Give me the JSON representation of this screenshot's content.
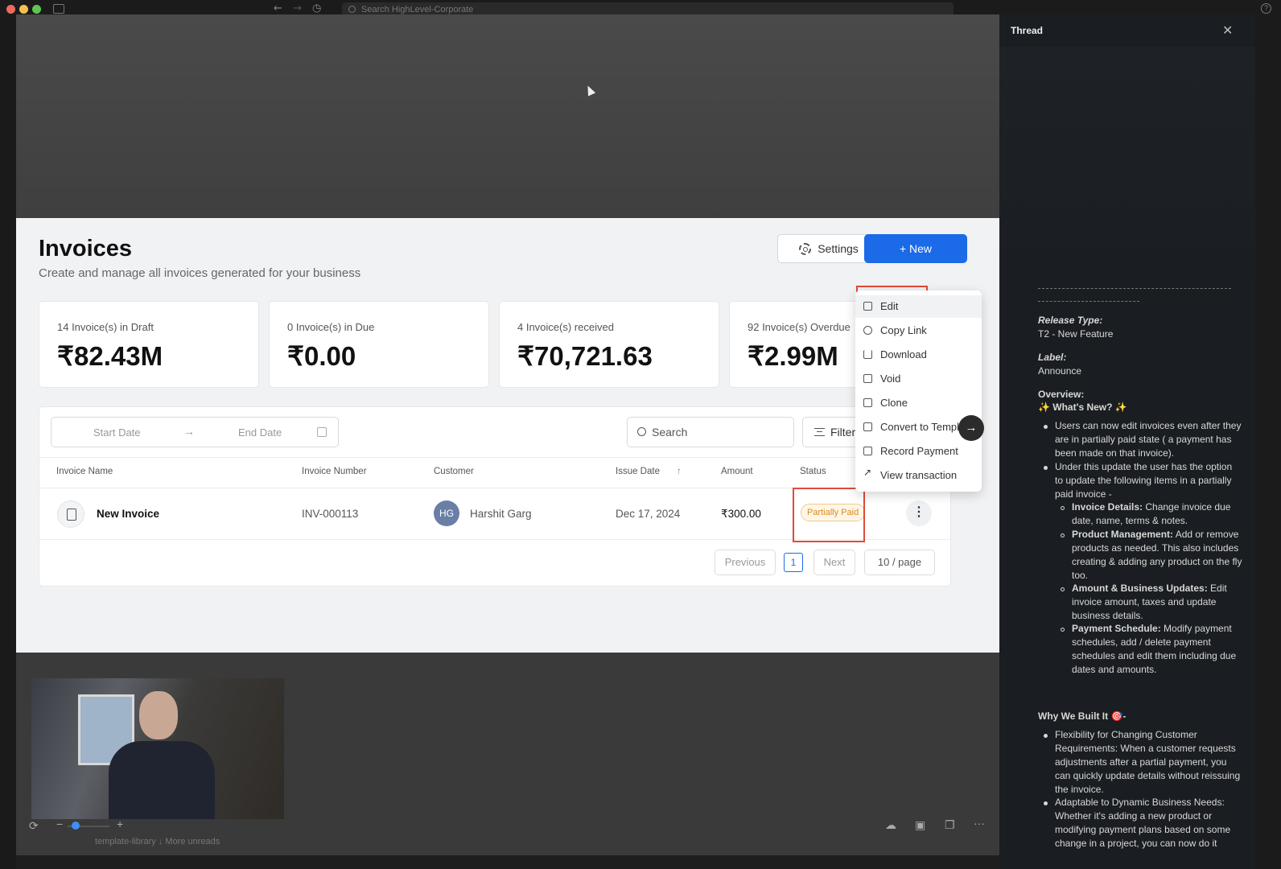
{
  "browser": {
    "search_placeholder": "Search HighLevel-Corporate",
    "help_label": "?"
  },
  "colors": {
    "accent_blue": "#1b6ae8",
    "partially_paid": "#d88a1e",
    "highlight_red": "#e04a3a"
  },
  "invoices": {
    "title": "Invoices",
    "subtitle": "Create and manage all invoices generated for your business",
    "settings_label": "Settings",
    "new_label": "+ New",
    "cards": [
      {
        "label": "14 Invoice(s) in Draft",
        "value": "₹82.43M"
      },
      {
        "label": "0 Invoice(s) in Due",
        "value": "₹0.00"
      },
      {
        "label": "4 Invoice(s) received",
        "value": "₹70,721.63"
      },
      {
        "label": "92 Invoice(s) Overdue",
        "value": "₹2.99M"
      }
    ],
    "start_date": "Start Date",
    "date_arrow": "→",
    "end_date": "End Date",
    "search_placeholder": "Search",
    "filters_label": "Filters",
    "columns": {
      "invoice_name": "Invoice Name",
      "invoice_number": "Invoice Number",
      "customer": "Customer",
      "issue_date": "Issue Date",
      "amount": "Amount",
      "status": "Status"
    },
    "sort_arrow": "↑",
    "row": {
      "name": "New Invoice",
      "number": "INV-000113",
      "avatar_initials": "HG",
      "customer": "Harshit Garg",
      "issue_date": "Dec 17, 2024",
      "amount": "₹300.00",
      "status": "Partially Paid",
      "more": "⋮"
    },
    "pager": {
      "previous": "Previous",
      "current": "1",
      "next": "Next",
      "per_page": "10 / page"
    }
  },
  "menu": {
    "items": [
      {
        "label": "Edit",
        "icon": "pencil-icon"
      },
      {
        "label": "Copy Link",
        "icon": "link-icon"
      },
      {
        "label": "Download",
        "icon": "download-icon"
      },
      {
        "label": "Void",
        "icon": "trash-icon"
      },
      {
        "label": "Clone",
        "icon": "clone-icon"
      },
      {
        "label": "Convert to Templa",
        "icon": "template-icon"
      },
      {
        "label": "Record Payment",
        "icon": "payment-icon"
      },
      {
        "label": "View transaction",
        "icon": "arrow-up-right-icon"
      }
    ],
    "arrow": "→"
  },
  "toolbar": {
    "zoom_minus": "−",
    "zoom_plus": "+",
    "more": "···",
    "bottom_text": "template-library   ↓ More unreads"
  },
  "thread": {
    "title": "Thread",
    "close": "✕",
    "release_type_label": "Release Type:",
    "release_type_value": "T2 - New Feature",
    "label_label": "Label:",
    "label_value": "Announce",
    "overview_label": "Overview:",
    "whats_new": "✨ What's New? ✨",
    "bullets": [
      "Users can now edit invoices even after they are in partially paid state ( a payment has been made on that invoice).",
      "Under this update the user has the option to update the following items in a partially paid invoice -"
    ],
    "sub_bullets": [
      {
        "head": "Invoice Details:",
        "body": " Change invoice due date, name, terms & notes."
      },
      {
        "head": "Product Management:",
        "body": " Add or remove products as needed. This also includes creating & adding any product on the fly too."
      },
      {
        "head": "Amount & Business Updates:",
        "body": " Edit invoice amount, taxes and update business details."
      },
      {
        "head": "Payment Schedule:",
        "body": " Modify payment schedules, add / delete payment schedules and edit them including due dates and amounts."
      }
    ],
    "why_built": "Why We Built It 🎯-",
    "why_bullets": [
      "Flexibility for Changing Customer Requirements: When a customer requests adjustments after a partial payment, you can quickly update details without reissuing the invoice.",
      "Adaptable to Dynamic Business Needs: Whether it's adding a new product or modifying payment plans based on some change in a project, you can now do it"
    ]
  }
}
